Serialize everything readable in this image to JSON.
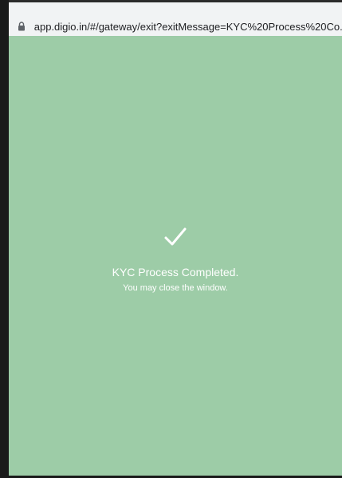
{
  "browser": {
    "url": "app.digio.in/#/gateway/exit?exitMessage=KYC%20Process%20Co...",
    "lock_icon": "lock-icon"
  },
  "page": {
    "background_color": "#9dcca7",
    "status_icon": "checkmark-icon",
    "title": "KYC Process Completed.",
    "subtitle": "You may close the window."
  }
}
